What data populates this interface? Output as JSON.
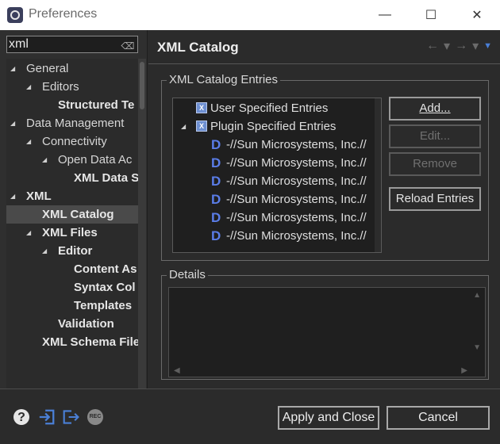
{
  "window": {
    "title": "Preferences",
    "minimize": "—",
    "maximize": "☐",
    "close": "✕"
  },
  "filter": {
    "value": "xml",
    "clear_glyph": "⌫"
  },
  "tree": [
    {
      "label": "General",
      "level": 0,
      "expanded": true,
      "bold": false
    },
    {
      "label": "Editors",
      "level": 1,
      "expanded": true,
      "bold": false
    },
    {
      "label": "Structured Te",
      "level": 2,
      "expanded": false,
      "bold": true
    },
    {
      "label": "Data Management",
      "level": 0,
      "expanded": true,
      "bold": false
    },
    {
      "label": "Connectivity",
      "level": 1,
      "expanded": true,
      "bold": false
    },
    {
      "label": "Open Data Ac",
      "level": 2,
      "expanded": true,
      "bold": false
    },
    {
      "label": "XML Data S",
      "level": 3,
      "expanded": false,
      "bold": true
    },
    {
      "label": "XML",
      "level": 0,
      "expanded": true,
      "bold": true
    },
    {
      "label": "XML Catalog",
      "level": 1,
      "expanded": false,
      "bold": true,
      "selected": true
    },
    {
      "label": "XML Files",
      "level": 1,
      "expanded": true,
      "bold": true
    },
    {
      "label": "Editor",
      "level": 2,
      "expanded": true,
      "bold": true
    },
    {
      "label": "Content As",
      "level": 3,
      "expanded": false,
      "bold": true
    },
    {
      "label": "Syntax Col",
      "level": 3,
      "expanded": false,
      "bold": true
    },
    {
      "label": "Templates",
      "level": 3,
      "expanded": false,
      "bold": true
    },
    {
      "label": "Validation",
      "level": 2,
      "expanded": false,
      "bold": true
    },
    {
      "label": "XML Schema File",
      "level": 1,
      "expanded": false,
      "bold": true
    }
  ],
  "page": {
    "title": "XML Catalog",
    "back_glyph": "←",
    "forward_glyph": "→",
    "dropdown_glyph": "▾",
    "menu_glyph": "▼"
  },
  "entries_group": {
    "label": "XML Catalog Entries",
    "items": [
      {
        "label": "User Specified Entries",
        "kind": "catalog",
        "twisty": ""
      },
      {
        "label": "Plugin Specified Entries",
        "kind": "catalog",
        "twisty": "◢"
      },
      {
        "label": "-//Sun Microsystems, Inc.//",
        "kind": "dtd"
      },
      {
        "label": "-//Sun Microsystems, Inc.//",
        "kind": "dtd"
      },
      {
        "label": "-//Sun Microsystems, Inc.//",
        "kind": "dtd"
      },
      {
        "label": "-//Sun Microsystems, Inc.//",
        "kind": "dtd"
      },
      {
        "label": "-//Sun Microsystems, Inc.//",
        "kind": "dtd"
      },
      {
        "label": "-//Sun Microsystems, Inc.//",
        "kind": "dtd"
      }
    ],
    "dtd_glyph": "D"
  },
  "buttons": {
    "add": "Add...",
    "edit": "Edit...",
    "remove": "Remove",
    "reload": "Reload Entries"
  },
  "details_group": {
    "label": "Details"
  },
  "footer": {
    "help_glyph": "?",
    "import_glyph": "⇥",
    "export_glyph": "⇨",
    "rec_label": "REC",
    "apply_close": "Apply and Close",
    "cancel": "Cancel"
  },
  "colors": {
    "background": "#2b2b2b",
    "accent_blue": "#4a7fd6",
    "dtd_blue": "#5a7de8"
  }
}
